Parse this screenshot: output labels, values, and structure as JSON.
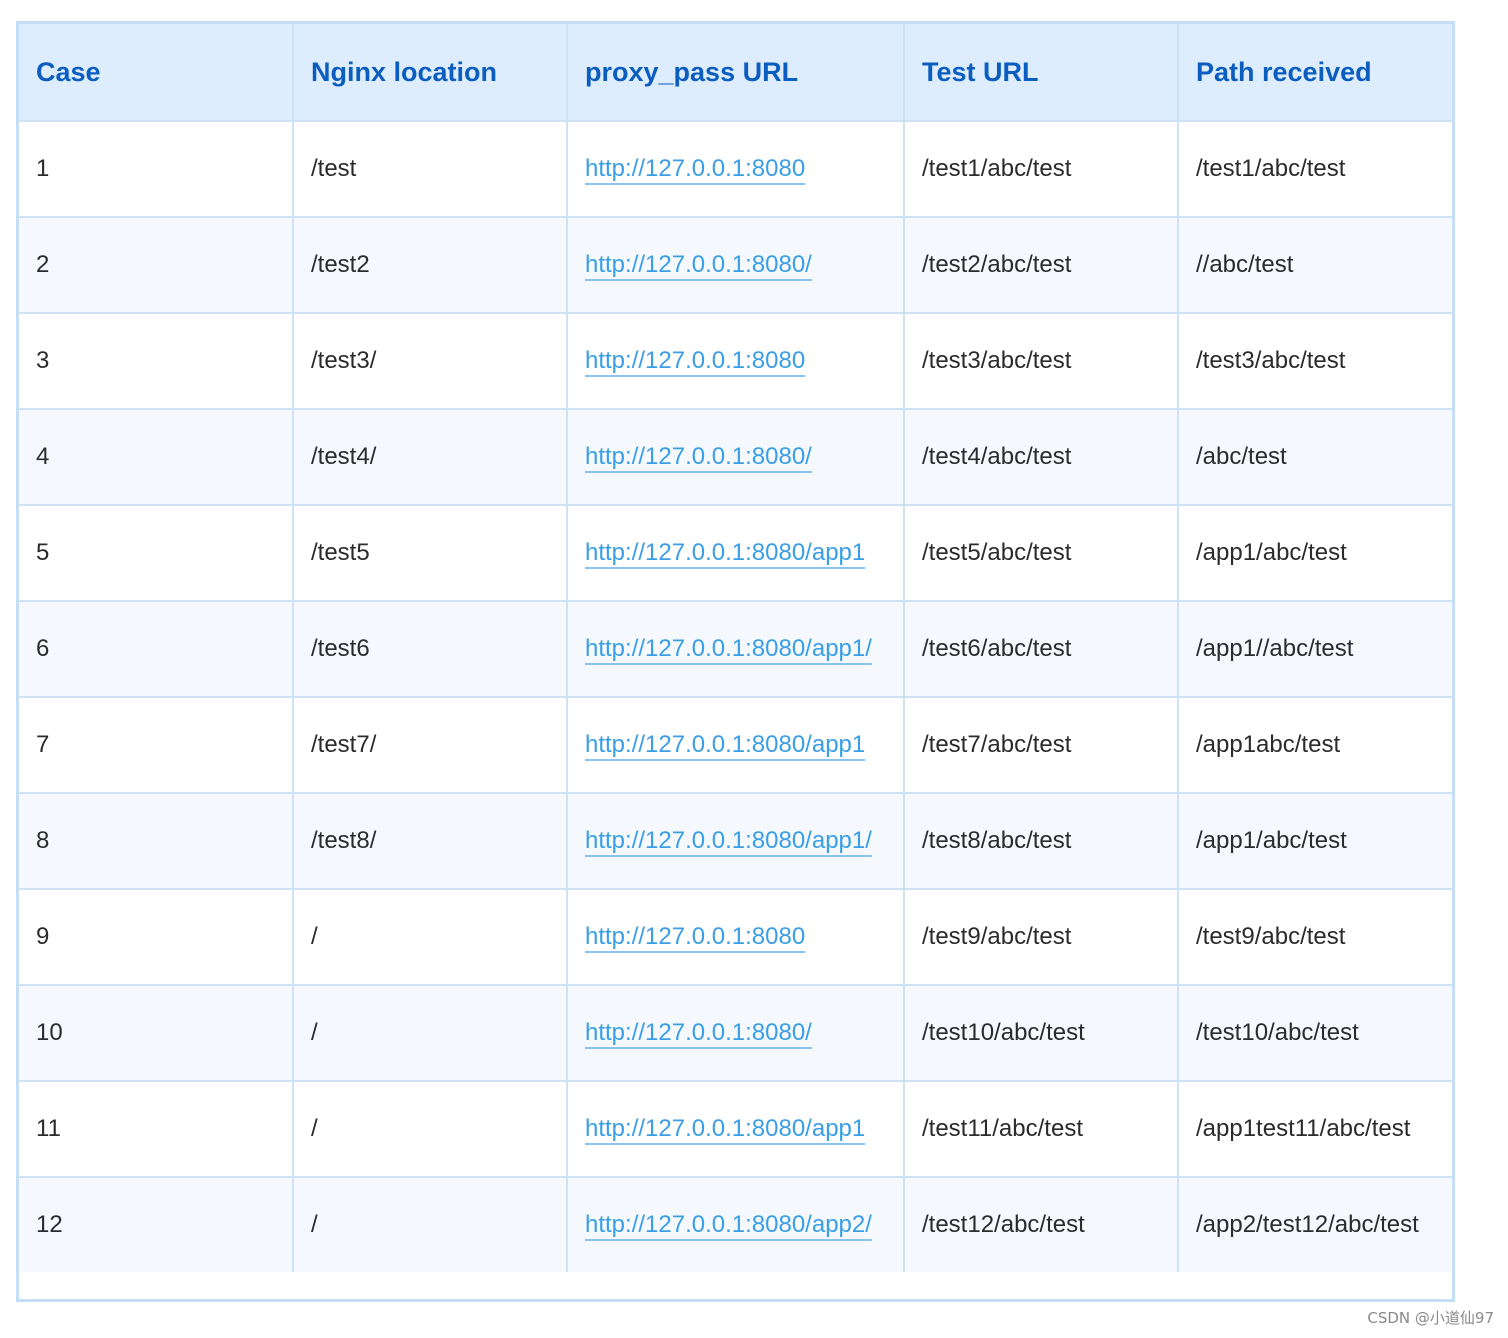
{
  "headers": [
    "Case",
    "Nginx location",
    "proxy_pass URL",
    "Test URL",
    "Path received"
  ],
  "rows": [
    {
      "case": "1",
      "location": "/test",
      "proxy_pass": "http://127.0.0.1:8080",
      "test_url": "/test1/abc/test",
      "received": "/test1/abc/test"
    },
    {
      "case": "2",
      "location": "/test2",
      "proxy_pass": "http://127.0.0.1:8080/",
      "test_url": "/test2/abc/test",
      "received": "//abc/test"
    },
    {
      "case": "3",
      "location": "/test3/",
      "proxy_pass": "http://127.0.0.1:8080",
      "test_url": "/test3/abc/test",
      "received": "/test3/abc/test"
    },
    {
      "case": "4",
      "location": "/test4/",
      "proxy_pass": "http://127.0.0.1:8080/",
      "test_url": "/test4/abc/test",
      "received": "/abc/test"
    },
    {
      "case": "5",
      "location": "/test5",
      "proxy_pass": "http://127.0.0.1:8080/app1",
      "test_url": "/test5/abc/test",
      "received": "/app1/abc/test"
    },
    {
      "case": "6",
      "location": "/test6",
      "proxy_pass": "http://127.0.0.1:8080/app1/",
      "test_url": "/test6/abc/test",
      "received": "/app1//abc/test"
    },
    {
      "case": "7",
      "location": "/test7/",
      "proxy_pass": "http://127.0.0.1:8080/app1",
      "test_url": "/test7/abc/test",
      "received": "/app1abc/test"
    },
    {
      "case": "8",
      "location": "/test8/",
      "proxy_pass": "http://127.0.0.1:8080/app1/",
      "test_url": "/test8/abc/test",
      "received": "/app1/abc/test"
    },
    {
      "case": "9",
      "location": "/",
      "proxy_pass": "http://127.0.0.1:8080",
      "test_url": "/test9/abc/test",
      "received": "/test9/abc/test"
    },
    {
      "case": "10",
      "location": "/",
      "proxy_pass": "http://127.0.0.1:8080/",
      "test_url": "/test10/abc/test",
      "received": "/test10/abc/test"
    },
    {
      "case": "11",
      "location": "/",
      "proxy_pass": "http://127.0.0.1:8080/app1",
      "test_url": "/test11/abc/test",
      "received": "/app1test11/abc/test"
    },
    {
      "case": "12",
      "location": "/",
      "proxy_pass": "http://127.0.0.1:8080/app2/",
      "test_url": "/test12/abc/test",
      "received": "/app2/test12/abc/test"
    }
  ],
  "watermark": "CSDN @小道仙97",
  "colors": {
    "header_bg": "#deedfd",
    "header_text": "#0b5ec0",
    "link": "#3a9ee6",
    "border": "#cfe2f5"
  }
}
